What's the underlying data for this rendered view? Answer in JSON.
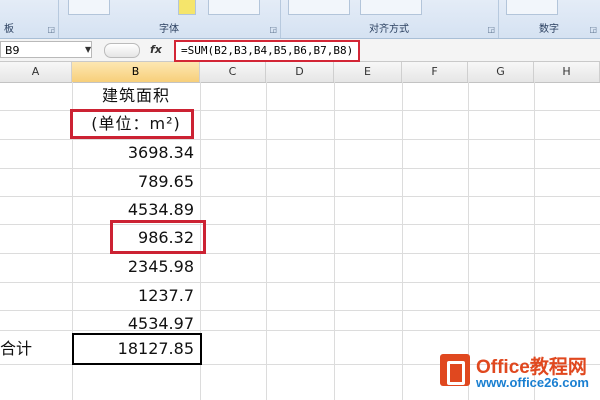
{
  "ribbon": {
    "groups": [
      "板",
      "字体",
      "对齐方式",
      "数字"
    ]
  },
  "formula_bar": {
    "name_box": "B9",
    "fx_label": "fx",
    "formula": "=SUM(B2,B3,B4,B5,B6,B7,B8)"
  },
  "columns": [
    "A",
    "B",
    "C",
    "D",
    "E",
    "F",
    "G",
    "H"
  ],
  "sheet": {
    "header_line1": "建筑面积",
    "header_line2": "(单位：m²)",
    "values": [
      "3698.34",
      "789.65",
      "4534.89",
      "986.32",
      "2345.98",
      "1237.7",
      "4534.97"
    ],
    "total_label": "合计",
    "total_value": "18127.85"
  },
  "watermark": {
    "title_en": "Office",
    "title_cn": "教程网",
    "url": "www.office26.com"
  },
  "colors": {
    "highlight_red": "#cc2233",
    "logo_orange": "#e0481f",
    "logo_blue": "#1a7fd1"
  }
}
